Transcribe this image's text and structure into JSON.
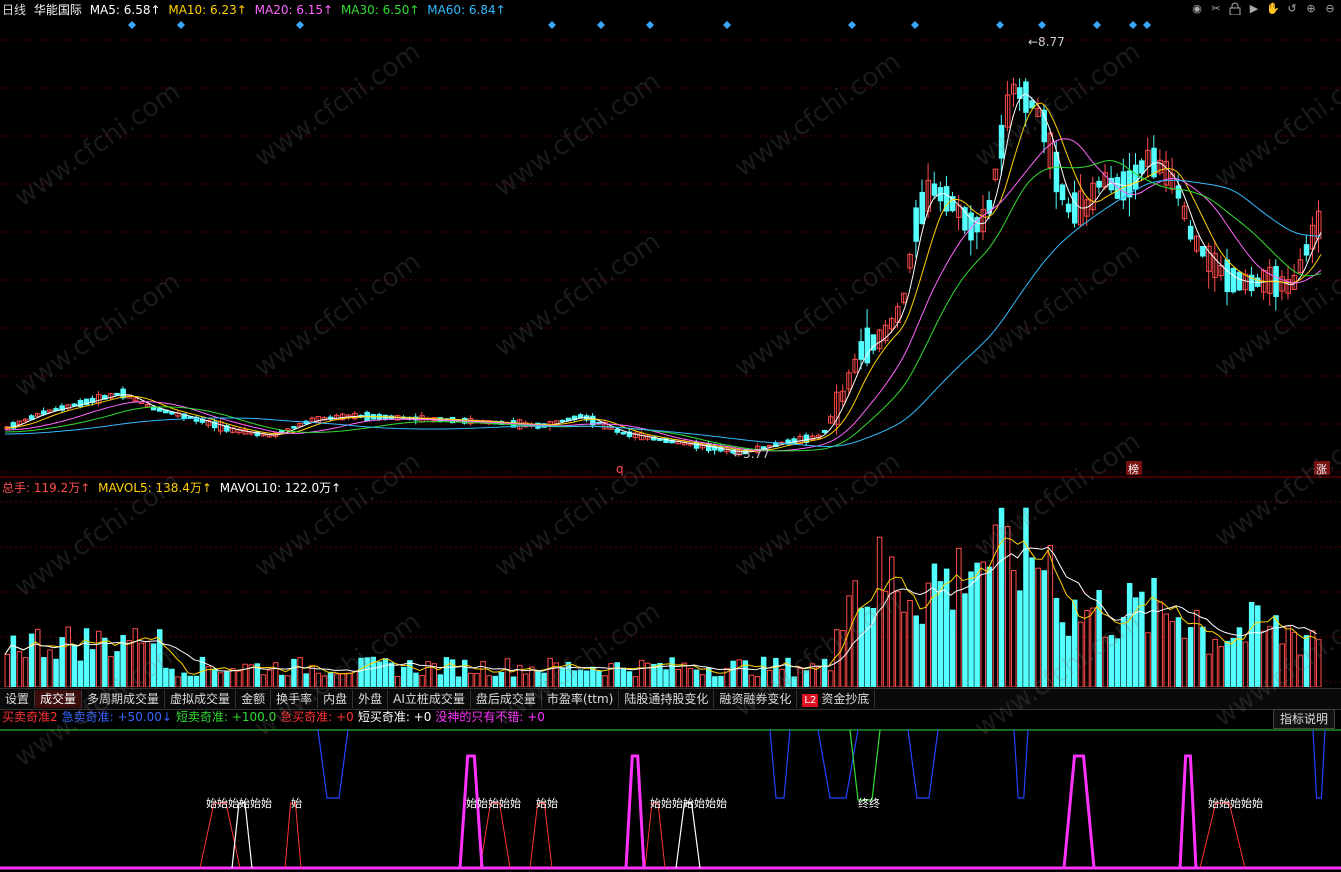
{
  "header": {
    "period": "日线",
    "stock_name": "华能国际",
    "ma": [
      {
        "label": "MA5: 6.58↑",
        "color": "#ffffff"
      },
      {
        "label": "MA10: 6.23↑",
        "color": "#ffd200"
      },
      {
        "label": "MA20: 6.15↑",
        "color": "#ff66ff"
      },
      {
        "label": "MA30: 6.50↑",
        "color": "#33dd33"
      },
      {
        "label": "MA60: 6.84↑",
        "color": "#33bbff"
      }
    ]
  },
  "toolbar_icons": [
    "eye-icon",
    "scissors-icon",
    "lock-icon",
    "play-icon",
    "hand-icon",
    "undo-icon",
    "zoom-in-icon",
    "zoom-out-icon"
  ],
  "toolbar_glyphs": [
    "◉",
    "✂",
    "🔒",
    "▶",
    "✋",
    "↺",
    "⊕",
    "⊖"
  ],
  "price": {
    "high_label": "8.77",
    "low_label": "3.77",
    "q_marker": "q",
    "bang_marker": "榜",
    "zhang_marker": "涨"
  },
  "volume": {
    "total_label": "总手: 119.2万↑",
    "mavol5_label": "MAVOL5: 138.4万↑",
    "mavol10_label": "MAVOL10: 122.0万↑"
  },
  "tabs": [
    "设置",
    "成交量",
    "多周期成交量",
    "虚拟成交量",
    "金额",
    "换手率",
    "内盘",
    "外盘",
    "AI立桩成交量",
    "盘后成交量",
    "市盈率(ttm)",
    "陆股通持股变化",
    "融资融券变化",
    "资金抄底"
  ],
  "active_tab": "成交量",
  "l2_badge": "L2",
  "indicator": {
    "items": [
      {
        "label": "买卖奇准2",
        "color": "#ff3333"
      },
      {
        "label": "急卖奇准: +50.00↓",
        "color": "#3366ff"
      },
      {
        "label": "短卖奇准: +100.0",
        "color": "#33dd33"
      },
      {
        "label": "急买奇准: +0",
        "color": "#ff3333"
      },
      {
        "label": "短买奇准: +0",
        "color": "#ffffff"
      },
      {
        "label": "没神的只有不错: +0",
        "color": "#ff33ff"
      }
    ],
    "explain_button": "指标说明",
    "signal_labels": [
      {
        "text": "始始始始始始",
        "color": "#ffffff"
      },
      {
        "text": "始",
        "color": "#ffffff"
      },
      {
        "text": "始始始始始",
        "color": "#ffffff"
      },
      {
        "text": "始始",
        "color": "#ffffff"
      },
      {
        "text": "始始始始始始始",
        "color": "#ffffff"
      },
      {
        "text": "终终",
        "color": "#ffffff"
      },
      {
        "text": "始始始始始",
        "color": "#ffffff"
      }
    ]
  },
  "watermark": "www.cfchi.com",
  "colors": {
    "up": "#ff4b4b",
    "down": "#54ffff",
    "grid": "#5a0000",
    "axis": "#8b0000"
  }
}
